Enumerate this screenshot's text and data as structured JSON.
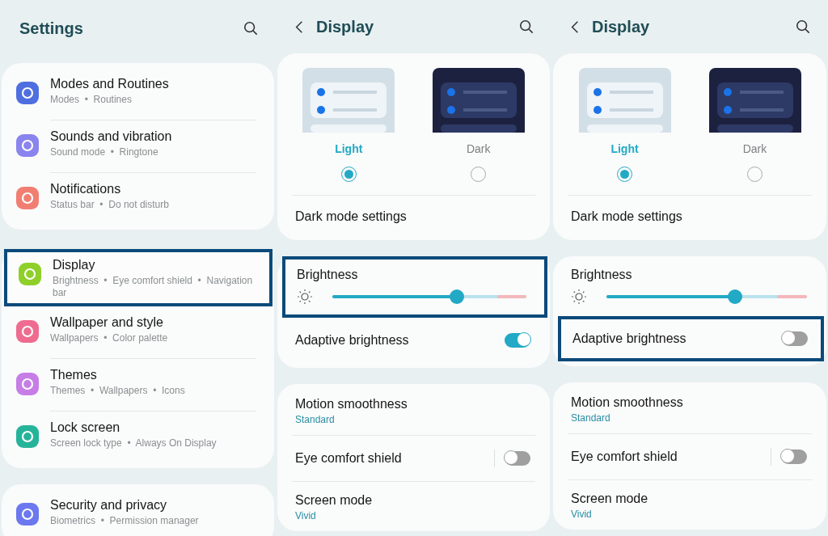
{
  "settings_screen": {
    "title": "Settings",
    "groups": [
      {
        "items": [
          {
            "title": "Modes and Routines",
            "subtitle": "Modes  •  Routines",
            "color": "#4f6fe0",
            "highlighted": false
          },
          {
            "title": "Sounds and vibration",
            "subtitle": "Sound mode  •  Ringtone",
            "color": "#8a84ee",
            "highlighted": false
          },
          {
            "title": "Notifications",
            "subtitle": "Status bar  •  Do not disturb",
            "color": "#f07f72",
            "highlighted": false
          }
        ]
      },
      {
        "items": [
          {
            "title": "Display",
            "subtitle": "Brightness  •  Eye comfort shield  •  Navigation bar",
            "color": "#8fcf2a",
            "highlighted": true
          },
          {
            "title": "Wallpaper and style",
            "subtitle": "Wallpapers  •  Color palette",
            "color": "#ee6c8f",
            "highlighted": false
          },
          {
            "title": "Themes",
            "subtitle": "Themes  •  Wallpapers  •  Icons",
            "color": "#c67ee6",
            "highlighted": false
          },
          {
            "title": "Lock screen",
            "subtitle": "Screen lock type  •  Always On Display",
            "color": "#25b49a",
            "highlighted": false
          }
        ]
      },
      {
        "items": [
          {
            "title": "Security and privacy",
            "subtitle": "Biometrics  •  Permission manager",
            "color": "#6b78ee",
            "highlighted": false
          }
        ]
      }
    ]
  },
  "display_screens": [
    {
      "title": "Display",
      "themes": [
        {
          "label": "Light",
          "kind": "light",
          "selected": true
        },
        {
          "label": "Dark",
          "kind": "dark",
          "selected": false
        }
      ],
      "dark_mode_settings": "Dark mode settings",
      "brightness": {
        "label": "Brightness",
        "level": 0.64,
        "highlighted": true
      },
      "adaptive_brightness": {
        "label": "Adaptive brightness",
        "on": true,
        "highlighted": false
      },
      "motion_smoothness": {
        "label": "Motion smoothness",
        "value": "Standard"
      },
      "eye_comfort_shield": {
        "label": "Eye comfort shield",
        "on": false
      },
      "screen_mode": {
        "label": "Screen mode",
        "value": "Vivid"
      }
    },
    {
      "title": "Display",
      "themes": [
        {
          "label": "Light",
          "kind": "light",
          "selected": true
        },
        {
          "label": "Dark",
          "kind": "dark",
          "selected": false
        }
      ],
      "dark_mode_settings": "Dark mode settings",
      "brightness": {
        "label": "Brightness",
        "level": 0.64,
        "highlighted": false
      },
      "adaptive_brightness": {
        "label": "Adaptive brightness",
        "on": false,
        "highlighted": true
      },
      "motion_smoothness": {
        "label": "Motion smoothness",
        "value": "Standard"
      },
      "eye_comfort_shield": {
        "label": "Eye comfort shield",
        "on": false
      },
      "screen_mode": {
        "label": "Screen mode",
        "value": "Vivid"
      }
    }
  ]
}
